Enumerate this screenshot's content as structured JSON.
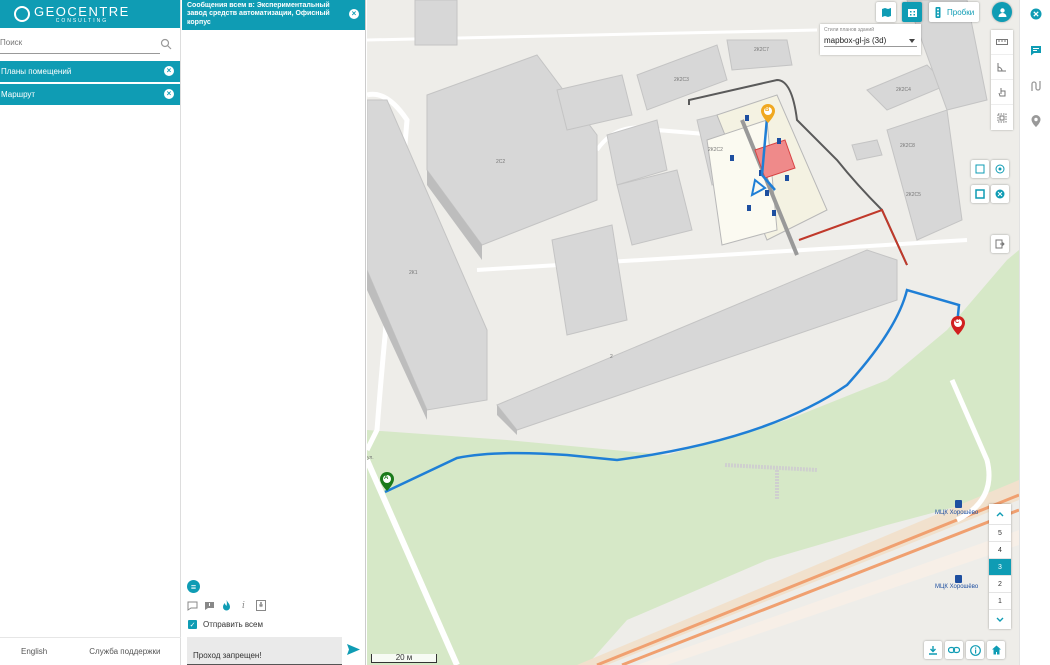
{
  "branding": {
    "name": "GEOCENTRE",
    "sub": "CONSULTING"
  },
  "search": {
    "placeholder": "Поиск"
  },
  "layers": [
    {
      "label": "Планы помещений"
    },
    {
      "label": "Маршрут"
    }
  ],
  "footer": {
    "language": "English",
    "support": "Служба поддержки"
  },
  "chat": {
    "title": "Сообщения всем в: Экспериментальный завод средств автоматизации, Офисный корпус",
    "send_all_label": "Отправить всем",
    "message_text": "Проход запрещен!"
  },
  "map": {
    "traffic_label": "Пробки",
    "style_label": "Стили планов зданий",
    "style_value": "mapbox-gl-js (3d)",
    "floors": [
      "5",
      "4",
      "3",
      "2",
      "1"
    ],
    "active_floor": "3",
    "scale_label": "20 м",
    "labels": {
      "b1": "2К2С8",
      "b2": "2К2С7",
      "b3": "2К2С3",
      "b4": "2К2С2",
      "b5": "2С2",
      "b6": "2К2С4",
      "b7": "2К2С5",
      "b8": "2К1",
      "b9": "2",
      "station1": "МЦК Хорошёво",
      "station2": "МЦК Хорошёво",
      "street": "ул."
    },
    "markers": {
      "start": "A",
      "mid": "B",
      "end": "C"
    }
  },
  "colors": {
    "accent": "#0f9cb4",
    "route": "#1f7fd6",
    "closed": "#c0392b"
  }
}
